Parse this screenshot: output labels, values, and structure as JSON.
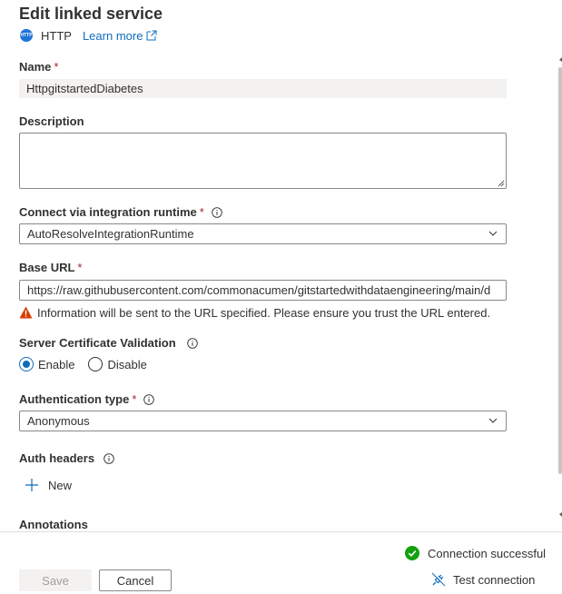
{
  "panel": {
    "title": "Edit linked service",
    "connector_icon_text": "HTTP",
    "connector_name": "HTTP",
    "learn_more": "Learn more"
  },
  "fields": {
    "name": {
      "label": "Name",
      "required": "*",
      "value": "HttpgitstartedDiabetes"
    },
    "description": {
      "label": "Description",
      "value": ""
    },
    "integration_runtime": {
      "label": "Connect via integration runtime",
      "required": "*",
      "value": "AutoResolveIntegrationRuntime"
    },
    "base_url": {
      "label": "Base URL",
      "required": "*",
      "value": "https://raw.githubusercontent.com/commonacumen/gitstartedwithdataengineering/main/d",
      "warning": "Information will be sent to the URL specified. Please ensure you trust the URL entered."
    },
    "cert_validation": {
      "label": "Server Certificate Validation",
      "options": [
        "Enable",
        "Disable"
      ],
      "selected": "Enable"
    },
    "auth_type": {
      "label": "Authentication type",
      "required": "*",
      "value": "Anonymous"
    },
    "auth_headers": {
      "label": "Auth headers",
      "new_label": "New"
    },
    "annotations": {
      "label": "Annotations"
    }
  },
  "footer": {
    "save_label": "Save",
    "cancel_label": "Cancel",
    "connection_status": "Connection successful",
    "test_connection": "Test connection"
  },
  "colors": {
    "accent": "#0f6cbd",
    "required": "#a4262c",
    "success": "#13a10e",
    "warning": "#d83b01"
  }
}
